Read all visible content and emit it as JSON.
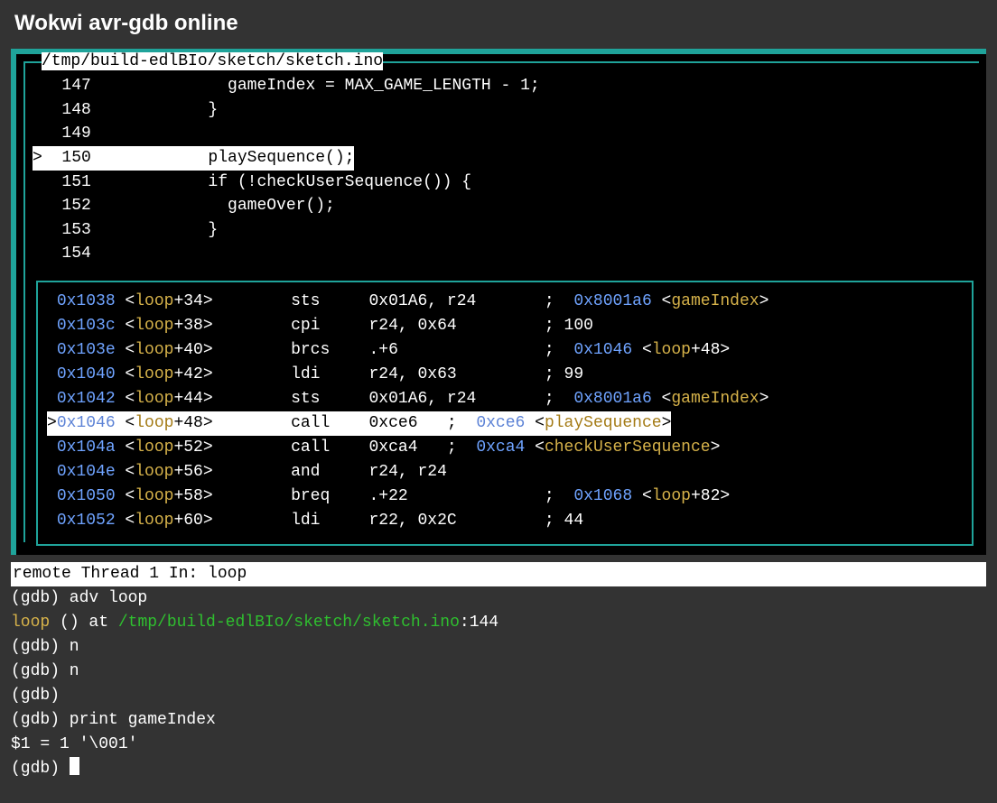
{
  "title": "Wokwi avr-gdb online",
  "source": {
    "path": "/tmp/build-edlBIo/sketch/sketch.ino",
    "current": 150,
    "lines": [
      {
        "n": 147,
        "text": "gameIndex = MAX_GAME_LENGTH - 1;",
        "indent2": true
      },
      {
        "n": 148,
        "text": "}"
      },
      {
        "n": 149,
        "text": ""
      },
      {
        "n": 150,
        "text": "playSequence();"
      },
      {
        "n": 151,
        "text": "if (!checkUserSequence()) {"
      },
      {
        "n": 152,
        "text": "gameOver();",
        "indent2": true
      },
      {
        "n": 153,
        "text": "}"
      },
      {
        "n": 154,
        "text": ""
      }
    ]
  },
  "asm": {
    "current": "0x1046",
    "rows": [
      {
        "addr": "0x1038",
        "sym": "loop",
        "off": "+34",
        "op": "sts",
        "args": "0x01A6, r24",
        "tail_addr": "0x8001a6",
        "tail_sym": "gameIndex"
      },
      {
        "addr": "0x103c",
        "sym": "loop",
        "off": "+38",
        "op": "cpi",
        "args": "r24, 0x64",
        "tail_text": "; 100"
      },
      {
        "addr": "0x103e",
        "sym": "loop",
        "off": "+40",
        "op": "brcs",
        "args": ".+6",
        "tail_addr": "0x1046",
        "tail_sym": "loop",
        "tail_off": "+48"
      },
      {
        "addr": "0x1040",
        "sym": "loop",
        "off": "+42",
        "op": "ldi",
        "args": "r24, 0x63",
        "tail_text": "; 99"
      },
      {
        "addr": "0x1042",
        "sym": "loop",
        "off": "+44",
        "op": "sts",
        "args": "0x01A6, r24",
        "tail_addr": "0x8001a6",
        "tail_sym": "gameIndex"
      },
      {
        "addr": "0x1046",
        "sym": "loop",
        "off": "+48",
        "op": "call",
        "args": "0xce6",
        "inline_addr": "0xce6",
        "inline_sym": "playSequence"
      },
      {
        "addr": "0x104a",
        "sym": "loop",
        "off": "+52",
        "op": "call",
        "args": "0xca4",
        "inline_addr": "0xca4",
        "inline_sym": "checkUserSequence"
      },
      {
        "addr": "0x104e",
        "sym": "loop",
        "off": "+56",
        "op": "and",
        "args": "r24, r24"
      },
      {
        "addr": "0x1050",
        "sym": "loop",
        "off": "+58",
        "op": "breq",
        "args": ".+22",
        "tail_addr": "0x1068",
        "tail_sym": "loop",
        "tail_off": "+82"
      },
      {
        "addr": "0x1052",
        "sym": "loop",
        "off": "+60",
        "op": "ldi",
        "args": "r22, 0x2C",
        "tail_text": "; 44"
      }
    ]
  },
  "console": {
    "status": "remote Thread 1 In: loop",
    "lines": [
      {
        "prompt": "(gdb) ",
        "cmd": "adv loop"
      },
      {
        "fn": "loop",
        "mid": " () at ",
        "path": "/tmp/build-edlBIo/sketch/sketch.ino",
        "tail": ":144"
      },
      {
        "prompt": "(gdb) ",
        "cmd": "n"
      },
      {
        "prompt": "(gdb) ",
        "cmd": "n"
      },
      {
        "prompt": "(gdb) ",
        "cmd": ""
      },
      {
        "prompt": "(gdb) ",
        "cmd": "print gameIndex"
      },
      {
        "plain": "$1 = 1 '\\001'"
      },
      {
        "prompt": "(gdb) ",
        "cursor": true
      }
    ]
  }
}
